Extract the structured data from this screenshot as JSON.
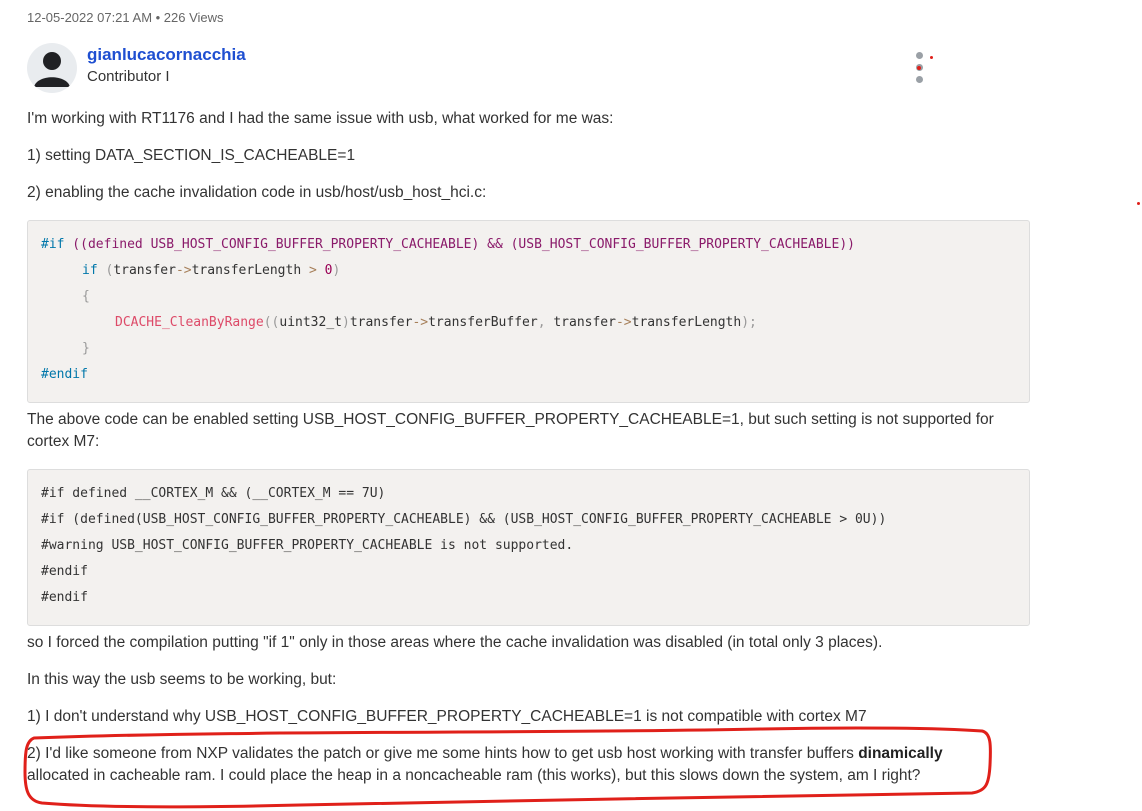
{
  "post": {
    "meta": "12-05-2022 07:21 AM • 226 Views",
    "author": "gianlucacornacchia",
    "rank": "Contributor I",
    "menu_icon": "kebab-menu-icon"
  },
  "body": {
    "p1": "I'm working with RT1176 and I had the same issue with usb, what worked for me was:",
    "p2": "1) setting DATA_SECTION_IS_CACHEABLE=1",
    "p3": "2) enabling the cache invalidation code in usb/host/usb_host_hci.c:",
    "code1": {
      "l1_kw": "#if",
      "l1_rest": " ((defined USB_HOST_CONFIG_BUFFER_PROPERTY_CACHEABLE) && (USB_HOST_CONFIG_BUFFER_PROPERTY_CACHEABLE))",
      "l2_kw": "if",
      "l2_open": " (",
      "l2_var": "transfer",
      "l2_arrow": "->",
      "l2_field": "transferLength",
      "l2_gt": " > ",
      "l2_num": "0",
      "l2_close": ")",
      "l3": "{",
      "l4_fn": "DCACHE_CleanByRange",
      "l4_p1": "((",
      "l4_type": "uint32_t",
      "l4_p2": ")",
      "l4_var1": "transfer",
      "l4_arrow1": "->",
      "l4_field1": "transferBuffer",
      "l4_comma": ", ",
      "l4_var2": "transfer",
      "l4_arrow2": "->",
      "l4_field2": "transferLength",
      "l4_end": ");",
      "l5": "}",
      "l6_kw": "#endif"
    },
    "p4": "The above code can be enabled setting USB_HOST_CONFIG_BUFFER_PROPERTY_CACHEABLE=1, but such setting is not supported for cortex M7:",
    "code2": [
      "#if defined __CORTEX_M && (__CORTEX_M == 7U)",
      "#if (defined(USB_HOST_CONFIG_BUFFER_PROPERTY_CACHEABLE) && (USB_HOST_CONFIG_BUFFER_PROPERTY_CACHEABLE > 0U))",
      "#warning USB_HOST_CONFIG_BUFFER_PROPERTY_CACHEABLE is not supported.",
      "#endif",
      "#endif"
    ],
    "p5": "so I forced the compilation putting \"if 1\" only in those areas where the cache invalidation was disabled (in total only 3 places).",
    "p6": "In this way the usb seems to be working, but:",
    "p7": "1) I don't understand why USB_HOST_CONFIG_BUFFER_PROPERTY_CACHEABLE=1 is not compatible with cortex M7",
    "p8_a": "2) I'd like someone from NXP validates the patch or give me some hints how to get usb host working with transfer buffers ",
    "p8_bold": "dinamically",
    "p8_b": " allocated in cacheable ram. I could place the heap in a noncacheable ram  (this works), but this slows down the system, am I right?"
  },
  "colors": {
    "username": "#1f4fd1",
    "annotation": "#e0201a",
    "code_bg": "#f3f1ef"
  }
}
